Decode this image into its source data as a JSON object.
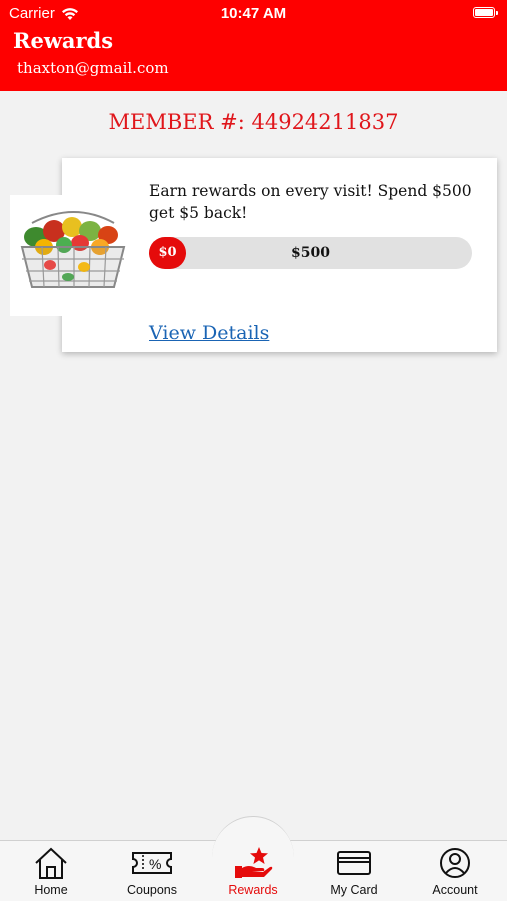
{
  "status_bar": {
    "carrier": "Carrier",
    "time": "10:47 AM"
  },
  "header": {
    "title": "Rewards",
    "email": "thaxton@gmail.com"
  },
  "member": {
    "label": "MEMBER #:",
    "number": "44924211837"
  },
  "reward": {
    "description": "Earn rewards on every visit! Spend $500 get $5 back!",
    "progress_current": "$0",
    "progress_goal": "$500",
    "progress_fraction": 0,
    "view_details": "View Details"
  },
  "tabs": [
    {
      "label": "Home",
      "icon": "home-icon"
    },
    {
      "label": "Coupons",
      "icon": "coupon-icon"
    },
    {
      "label": "Rewards",
      "icon": "rewards-hand-star-icon",
      "active": true
    },
    {
      "label": "My Card",
      "icon": "card-icon"
    },
    {
      "label": "Account",
      "icon": "account-icon"
    }
  ],
  "colors": {
    "brand_red": "#fe0000",
    "link_blue": "#1a64b4",
    "background": "#f2f2f2"
  }
}
